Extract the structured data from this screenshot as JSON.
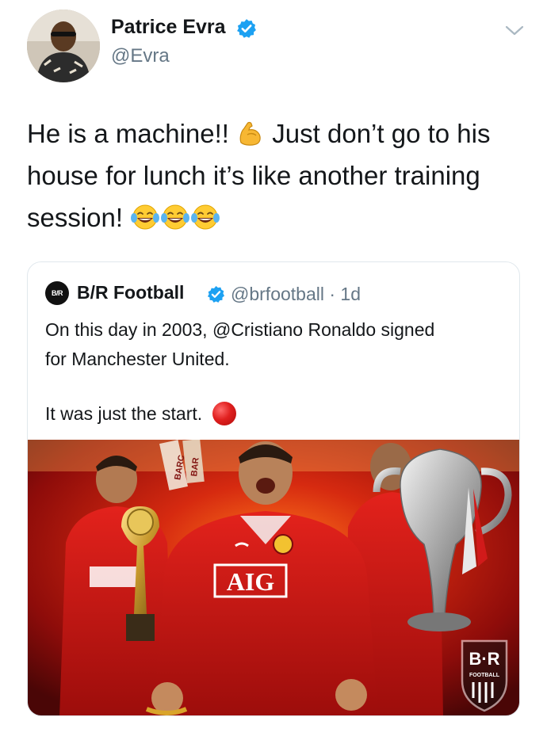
{
  "author": {
    "name": "Patrice Evra",
    "handle": "@Evra",
    "verified": true
  },
  "tweet": {
    "line1_a": "He is a machine!! ",
    "line1_b": " Just don’t go to his",
    "line2": "house for lunch it’s like another training",
    "line3": "session! "
  },
  "quoted": {
    "avatar_text": "B/R",
    "name": "B/R Football",
    "handle": "@brfootball · 1d",
    "verified": true,
    "line1": "On this day in 2003, @Cristiano Ronaldo signed",
    "line2": "for Manchester United.",
    "line3": "It was just the start. ",
    "image": {
      "shirt_sponsor": "AIG",
      "logo_text": "B·R",
      "logo_subtext": "FOOTBALL",
      "banner_text_1": "BARC",
      "banner_text_2": "BAR"
    }
  },
  "colors": {
    "verified": "#1da1f2",
    "secondary_text": "#657786",
    "image_red": "#b3120f"
  },
  "icons": {
    "verified": "verified-badge-icon",
    "menu": "chevron-down-icon",
    "flexed_biceps": "flexed-biceps-emoji",
    "tears_of_joy": "face-with-tears-of-joy-emoji",
    "red_circle": "red-circle-emoji"
  }
}
